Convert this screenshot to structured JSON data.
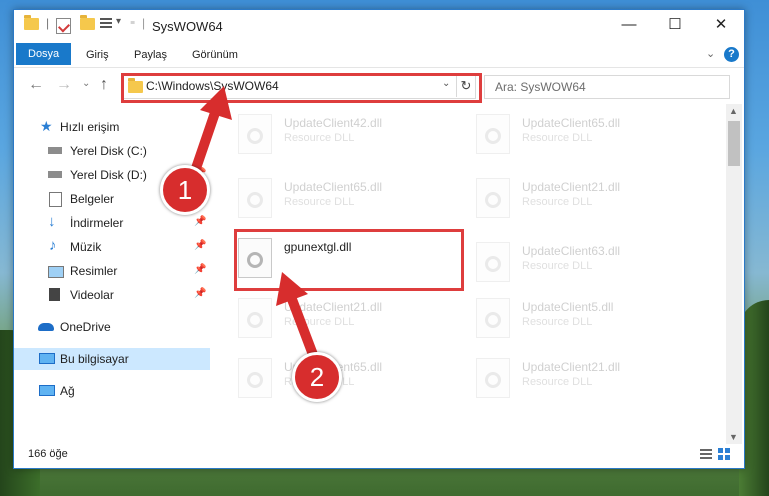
{
  "window": {
    "title": "SysWOW64",
    "controls": {
      "minimize": "—",
      "maximize": "☐",
      "close": "✕"
    }
  },
  "ribbon": {
    "tabs": [
      "Dosya",
      "Giriş",
      "Paylaş",
      "Görünüm"
    ],
    "expand": "⌄",
    "help": "?"
  },
  "address": {
    "path": "C:\\Windows\\SysWOW64",
    "search_placeholder": "Ara: SysWOW64"
  },
  "sidebar": {
    "items": [
      {
        "label": "Hızlı erişim",
        "icon": "star-icon",
        "pinned": false
      },
      {
        "label": "Yerel Disk (C:)",
        "icon": "drive-icon",
        "pinned": true
      },
      {
        "label": "Yerel Disk (D:)",
        "icon": "drive-icon",
        "pinned": true
      },
      {
        "label": "Belgeler",
        "icon": "documents-icon",
        "pinned": true
      },
      {
        "label": "İndirmeler",
        "icon": "downloads-icon",
        "pinned": true
      },
      {
        "label": "Müzik",
        "icon": "music-icon",
        "pinned": true
      },
      {
        "label": "Resimler",
        "icon": "pictures-icon",
        "pinned": true
      },
      {
        "label": "Videolar",
        "icon": "videos-icon",
        "pinned": true
      },
      {
        "label": "OneDrive",
        "icon": "cloud-icon",
        "pinned": false
      },
      {
        "label": "Bu bilgisayar",
        "icon": "computer-icon",
        "pinned": false
      },
      {
        "label": "Ağ",
        "icon": "network-icon",
        "pinned": false
      }
    ]
  },
  "files": [
    {
      "name": "UpdateClient42.dll",
      "type": "Resource DLL"
    },
    {
      "name": "UpdateClient65.dll",
      "type": "Resource DLL"
    },
    {
      "name": "UpdateClient65.dll",
      "type": "Resource DLL"
    },
    {
      "name": "UpdateClient21.dll",
      "type": "Resource DLL"
    },
    {
      "name": "gpunextgl.dll",
      "type": ""
    },
    {
      "name": "UpdateClient63.dll",
      "type": "Resource DLL"
    },
    {
      "name": "UpdateClient21.dll",
      "type": "Resource DLL"
    },
    {
      "name": "UpdateClient5.dll",
      "type": "Resource DLL"
    },
    {
      "name": "UpdateClient65.dll",
      "type": "Resource DLL"
    },
    {
      "name": "UpdateClient21.dll",
      "type": "Resource DLL"
    }
  ],
  "status": {
    "count": "166 öğe"
  },
  "annotations": {
    "step1": "1",
    "step2": "2"
  },
  "colors": {
    "highlight": "#de3d3d",
    "accent": "#1979ca"
  }
}
